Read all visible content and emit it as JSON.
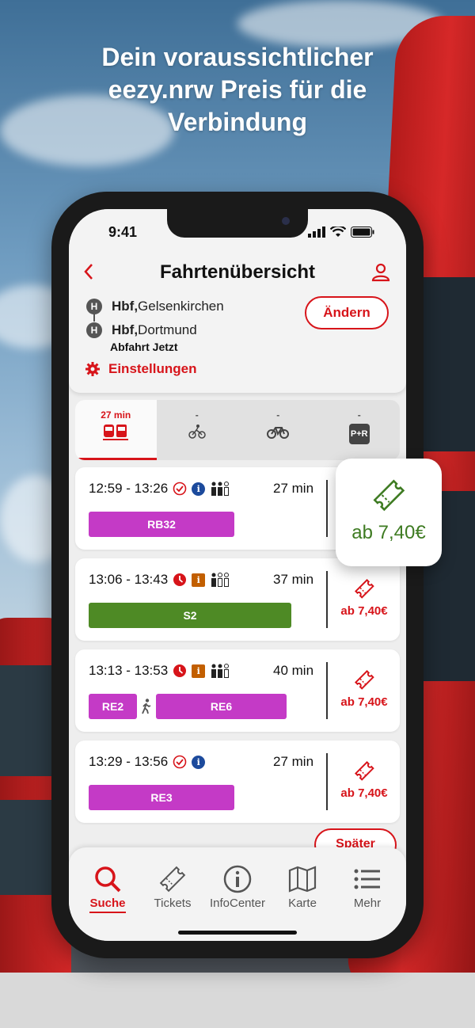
{
  "headline": [
    "Dein voraussichtlicher",
    "eezy.nrw Preis für die",
    "Verbindung"
  ],
  "status": {
    "time": "9:41"
  },
  "header": {
    "title": "Fahrtenübersicht",
    "from_station_bold": "Hbf,",
    "from_city": " Gelsenkirchen",
    "to_station_bold": "Hbf,",
    "to_city": " Dortmund",
    "stop_badge": "H",
    "departure": "Abfahrt Jetzt",
    "change_button": "Ändern",
    "settings": "Einstellungen"
  },
  "modes": [
    {
      "duration": "27 min",
      "icon": "train-bus-icon"
    },
    {
      "duration": "-",
      "icon": "bike-icon"
    },
    {
      "duration": "-",
      "icon": "bike-share-icon"
    },
    {
      "duration": "-",
      "icon": "park-ride-icon",
      "badge": "P+R"
    }
  ],
  "trips": [
    {
      "time": "12:59 - 13:26",
      "duration": "27 min",
      "price": "ab 7,40€",
      "status": "on-time",
      "info": "i",
      "lines": [
        {
          "name": "RB32",
          "color": "#c43ac6"
        }
      ]
    },
    {
      "time": "13:06 - 13:43",
      "duration": "37 min",
      "price": "ab 7,40€",
      "status": "delayed",
      "info": "i",
      "lines": [
        {
          "name": "S2",
          "color": "#4e8a25"
        }
      ]
    },
    {
      "time": "13:13 - 13:53",
      "duration": "40 min",
      "price": "ab 7,40€",
      "status": "delayed",
      "info": "i",
      "lines": [
        {
          "name": "RE2",
          "color": "#c43ac6"
        },
        {
          "name": "RE6",
          "color": "#c43ac6"
        }
      ]
    },
    {
      "time": "13:29 - 13:56",
      "duration": "27 min",
      "price": "ab 7,40€",
      "status": "on-time",
      "info": "i",
      "lines": [
        {
          "name": "RE3",
          "color": "#c43ac6"
        }
      ]
    }
  ],
  "later_button": "Später",
  "popout_price": "ab 7,40€",
  "tabs": [
    {
      "label": "Suche",
      "icon": "search-icon"
    },
    {
      "label": "Tickets",
      "icon": "ticket-icon"
    },
    {
      "label": "InfoCenter",
      "icon": "info-icon"
    },
    {
      "label": "Karte",
      "icon": "map-icon"
    },
    {
      "label": "Mehr",
      "icon": "menu-icon"
    }
  ],
  "colors": {
    "accent": "#d7141a",
    "price_green": "#3e7b22",
    "regional": "#c43ac6",
    "sbahn": "#4e8a25"
  }
}
